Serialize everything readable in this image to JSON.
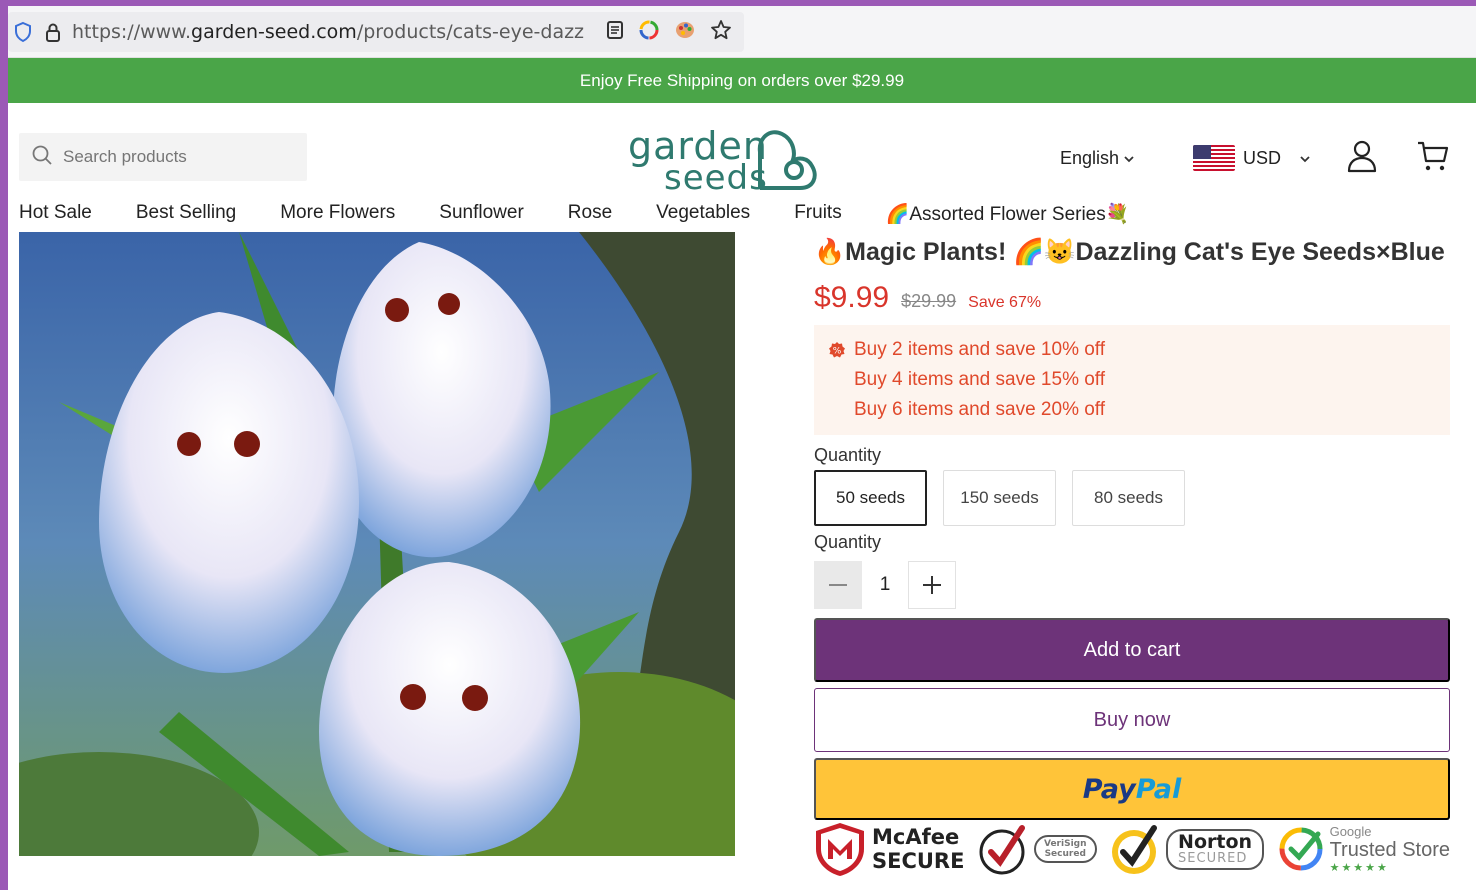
{
  "browser": {
    "url_prefix": "https://www.",
    "url_domain": "garden-seed.com",
    "url_path": "/products/cats-eye-dazz"
  },
  "banner": {
    "text": "Enjoy Free Shipping on orders over $29.99"
  },
  "header": {
    "search_placeholder": "Search products",
    "logo_line1": "garden",
    "logo_line2": "seeds",
    "language": "English",
    "currency": "USD"
  },
  "nav": {
    "items": [
      "Hot Sale",
      "Best Selling",
      "More Flowers",
      "Sunflower",
      "Rose",
      "Vegetables",
      "Fruits",
      "🌈Assorted Flower Series💐"
    ]
  },
  "product": {
    "title": "🔥Magic Plants! 🌈😺Dazzling Cat's Eye Seeds×Blue",
    "price": "$9.99",
    "compare_price": "$29.99",
    "save_text": "Save 67%",
    "discounts": [
      "Buy 2 items and save 10% off",
      "Buy 4 items and save 15% off",
      "Buy 6 items and save 20% off"
    ],
    "variant_label": "Quantity",
    "variants": [
      "50 seeds",
      "150 seeds",
      "80 seeds"
    ],
    "selected_variant": "50 seeds",
    "quantity_label": "Quantity",
    "quantity_value": "1",
    "add_to_cart": "Add to cart",
    "buy_now": "Buy now",
    "paypal_a": "Pay",
    "paypal_b": "Pal"
  },
  "trust_badges": {
    "mcafee_line1": "McAfee",
    "mcafee_line2": "SECURE",
    "verisign_line1": "VeriSign",
    "verisign_line2": "Secured",
    "norton_line1": "Norton",
    "norton_line2": "SECURED",
    "google_label": "Google",
    "trusted_store": "Trusted Store"
  },
  "colors": {
    "banner_green": "#4aa548",
    "brand_teal": "#2f7a6f",
    "price_red": "#d9352b",
    "button_purple": "#6d3379",
    "paypal_yellow": "#ffc439"
  }
}
